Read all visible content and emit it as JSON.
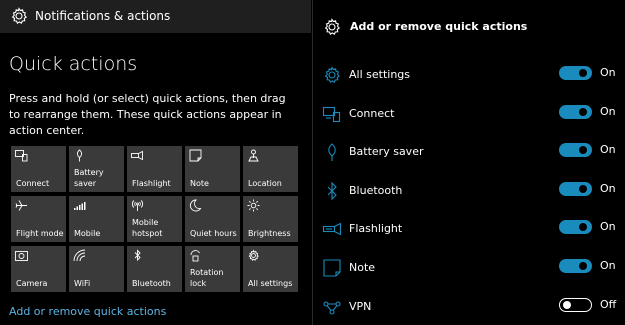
{
  "left": {
    "header_title": "Notifications & actions",
    "section_title": "Quick actions",
    "description": "Press and hold (or select) quick actions, then drag to rearrange them. These quick actions appear in action center.",
    "tiles": [
      {
        "label": "Connect",
        "icon": "connect-icon"
      },
      {
        "label": "Battery saver",
        "icon": "battery-saver-icon"
      },
      {
        "label": "Flashlight",
        "icon": "flashlight-icon"
      },
      {
        "label": "Note",
        "icon": "note-icon"
      },
      {
        "label": "Location",
        "icon": "location-icon"
      },
      {
        "label": "Flight mode",
        "icon": "airplane-icon"
      },
      {
        "label": "Mobile",
        "icon": "signal-icon"
      },
      {
        "label": "Mobile hotspot",
        "icon": "hotspot-icon"
      },
      {
        "label": "Quiet hours",
        "icon": "moon-icon"
      },
      {
        "label": "Brightness",
        "icon": "sun-icon"
      },
      {
        "label": "Camera",
        "icon": "camera-icon"
      },
      {
        "label": "WiFi",
        "icon": "wifi-icon"
      },
      {
        "label": "Bluetooth",
        "icon": "bluetooth-icon"
      },
      {
        "label": "Rotation lock",
        "icon": "rotation-lock-icon"
      },
      {
        "label": "All settings",
        "icon": "gear-icon"
      }
    ],
    "link_label": "Add or remove quick actions"
  },
  "right": {
    "header_title": "Add or remove quick actions",
    "rows": [
      {
        "label": "All settings",
        "state": "On",
        "on": true,
        "icon": "gear-icon"
      },
      {
        "label": "Connect",
        "state": "On",
        "on": true,
        "icon": "connect-icon"
      },
      {
        "label": "Battery saver",
        "state": "On",
        "on": true,
        "icon": "battery-saver-icon"
      },
      {
        "label": "Bluetooth",
        "state": "On",
        "on": true,
        "icon": "bluetooth-icon"
      },
      {
        "label": "Flashlight",
        "state": "On",
        "on": true,
        "icon": "flashlight-icon"
      },
      {
        "label": "Note",
        "state": "On",
        "on": true,
        "icon": "note-icon"
      },
      {
        "label": "VPN",
        "state": "Off",
        "on": false,
        "icon": "vpn-icon"
      }
    ]
  },
  "colors": {
    "accent": "#1a8bbd",
    "link": "#5db4e4",
    "tile_bg": "#3a3a3a",
    "header_bg": "#1f1f1f"
  }
}
